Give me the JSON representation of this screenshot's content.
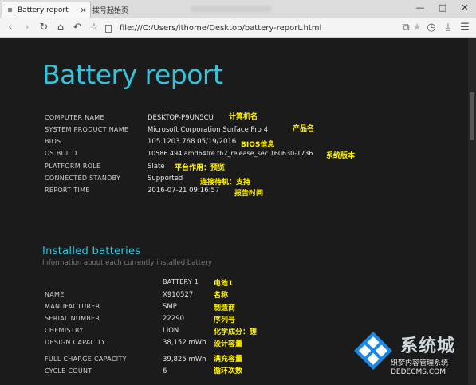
{
  "browser": {
    "active_tab_title": "Battery report",
    "inactive_tab_title": "拨号起始页",
    "address": "file:///C:/Users/ithome/Desktop/battery-report.html"
  },
  "report": {
    "title": "Battery report",
    "system": [
      {
        "label": "COMPUTER NAME",
        "value": "DESKTOP-P9UN5CU",
        "annotation": "计算机名"
      },
      {
        "label": "SYSTEM PRODUCT NAME",
        "value": "Microsoft Corporation Surface Pro 4",
        "annotation": "产品名"
      },
      {
        "label": "BIOS",
        "value": "105.1203.768 05/19/2016",
        "annotation": "BIOS信息"
      },
      {
        "label": "OS BUILD",
        "value": "10586.494.amd64fre.th2_release_sec.160630-1736",
        "annotation": "系统版本"
      },
      {
        "label": "PLATFORM ROLE",
        "value": "Slate",
        "annotation": "平台作用：预览"
      },
      {
        "label": "CONNECTED STANDBY",
        "value": "Supported",
        "annotation": "连接待机：支持"
      },
      {
        "label": "REPORT TIME",
        "value": "2016-07-21 09:16:57",
        "annotation": "报告时间"
      }
    ],
    "installed_batteries": {
      "heading": "Installed batteries",
      "subtitle": "Information about each currently installed battery",
      "battery_header": "BATTERY 1",
      "battery_header_annotation": "电池1",
      "rows": [
        {
          "label": "NAME",
          "value": "X910527",
          "annotation": "名称"
        },
        {
          "label": "MANUFACTURER",
          "value": "SMP",
          "annotation": "制造商"
        },
        {
          "label": "SERIAL NUMBER",
          "value": "22290",
          "annotation": "序列号"
        },
        {
          "label": "CHEMISTRY",
          "value": "LION",
          "annotation": "化学成分：锂"
        },
        {
          "label": "DESIGN CAPACITY",
          "value": "38,152 mWh",
          "annotation": "设计容量"
        },
        {
          "label": "FULL CHARGE CAPACITY",
          "value": "39,825 mWh",
          "annotation": "满充容量"
        },
        {
          "label": "CYCLE COUNT",
          "value": "6",
          "annotation": "循环次数"
        }
      ]
    }
  },
  "watermark": {
    "brand": "系统城",
    "line1": "织梦内容管理系统",
    "line2": "DEDECMS.COM"
  },
  "colors": {
    "accent": "#35c3dc",
    "annotation": "#fff200",
    "background": "#1b1b1b"
  }
}
